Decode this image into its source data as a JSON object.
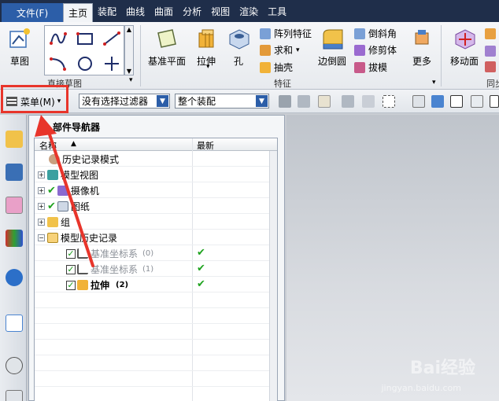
{
  "menubar": {
    "file": "文件(F)",
    "tabs": [
      "主页",
      "装配",
      "曲线",
      "曲面",
      "分析",
      "视图",
      "渲染",
      "工具"
    ],
    "active_tab": "主页"
  },
  "ribbon": {
    "sketch_button": "草图",
    "sketch_group": "直接草图",
    "datum_plane": "基准平面",
    "extrude": "拉伸",
    "hole": "孔",
    "pattern_feature": "阵列特征",
    "unite": "求和",
    "shell": "抽壳",
    "edge_blend": "边倒圆",
    "chamfer": "倒斜角",
    "trim_body": "修剪体",
    "draft": "拔模",
    "more": "更多",
    "move_face": "移动面",
    "feature_group": "特征",
    "sync_group_partial": "同步"
  },
  "toolbar": {
    "menu_label": "菜单(M)",
    "filter_value": "没有选择过滤器",
    "assembly_value": "整个装配"
  },
  "navigator": {
    "title": "部件导航器",
    "col_name": "名称",
    "col_latest": "最新",
    "rows": {
      "history_mode": "历史记录模式",
      "model_views": "模型视图",
      "cameras": "摄像机",
      "drawings": "图纸",
      "group": "组",
      "model_history": "模型历史记录",
      "datum_csys_0": "基准坐标系",
      "datum_csys_0_idx": "(0)",
      "datum_csys_1": "基准坐标系",
      "datum_csys_1_idx": "(1)",
      "extrude_2": "拉伸",
      "extrude_2_idx": "(2)"
    }
  },
  "watermark": {
    "brand": "Bai经验",
    "url": "jingyan.baidu.com"
  },
  "colors": {
    "menubar_bg": "#1f2e4a",
    "file_tab": "#2c5ea8",
    "highlight_red": "#e8352b",
    "check_green": "#1fa31f"
  }
}
